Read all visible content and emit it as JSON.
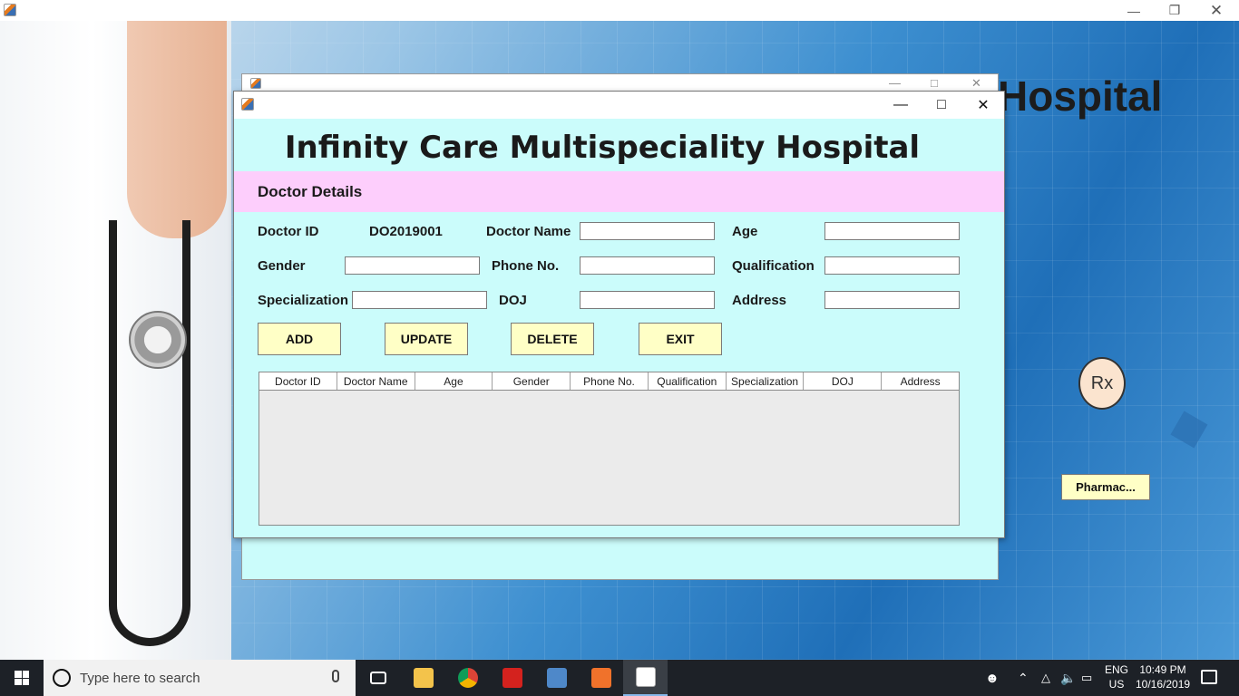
{
  "background": {
    "title_fragment": "Hospital",
    "pharmacy_button": "Pharmac...",
    "rx_label": "Rx"
  },
  "doctor_window": {
    "hospital_title": "Infinity Care Multispeciality Hospital",
    "section_title": "Doctor Details",
    "labels": {
      "doctor_id": "Doctor ID",
      "doctor_name": "Doctor Name",
      "age": "Age",
      "gender": "Gender",
      "phone": "Phone No.",
      "qualification": "Qualification",
      "specialization": "Specialization",
      "doj": "DOJ",
      "address": "Address"
    },
    "doctor_id_value": "DO2019001",
    "fields": {
      "doctor_name": "",
      "age": "",
      "gender": "",
      "phone": "",
      "qualification": "",
      "specialization": "",
      "doj": "",
      "address": ""
    },
    "buttons": {
      "add": "ADD",
      "update": "UPDATE",
      "delete": "DELETE",
      "exit": "EXIT"
    },
    "table_columns": [
      "Doctor ID",
      "Doctor Name",
      "Age",
      "Gender",
      "Phone No.",
      "Qualification",
      "Specialization",
      "DOJ",
      "Address"
    ],
    "table_rows": []
  },
  "taskbar": {
    "search_placeholder": "Type here to search",
    "apps": [
      "task-view",
      "file-explorer",
      "chrome",
      "acrobat",
      "virtualbox",
      "xampp",
      "java"
    ],
    "language": "ENG",
    "region": "US",
    "time": "10:49 PM",
    "date": "10/16/2019"
  },
  "colors": {
    "window_bg": "#cbfcfb",
    "section_band": "#fdcefc",
    "button_bg": "#ffffc6",
    "taskbar": "#1d2127"
  }
}
